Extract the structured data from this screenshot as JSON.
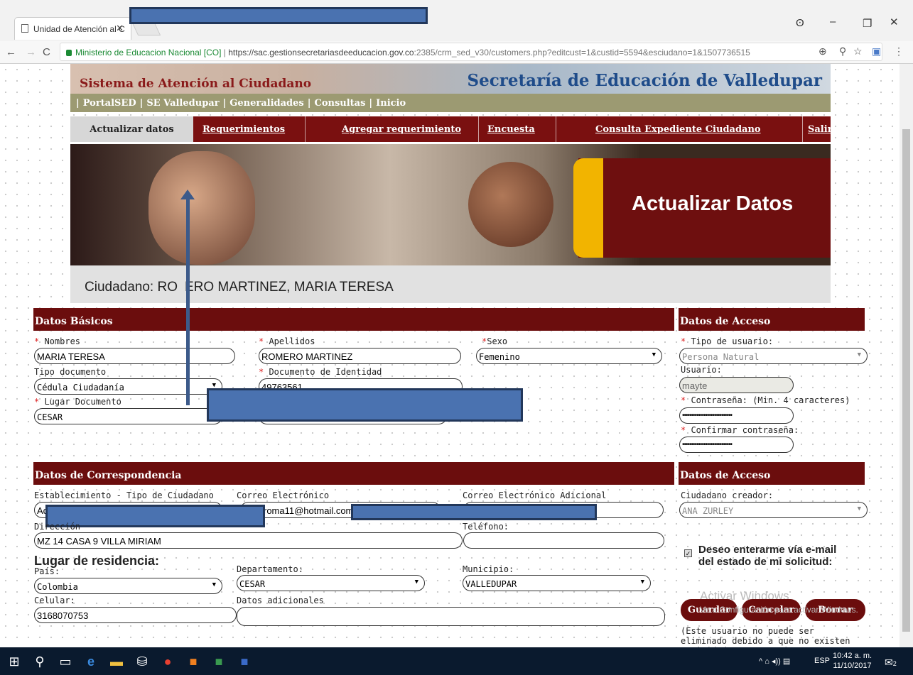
{
  "browser": {
    "tab_title": "Unidad de Atención al C",
    "url_org": "Ministerio de Educacion Nacional [CO]",
    "url_sep": " | ",
    "url_host": "https://sac.gestionsecretariasdeeducacion.gov.co",
    "url_path": ":2385/crm_sed_v30/customers.php?editcust=1&custid=5594&esciudano=1&1507736515"
  },
  "banner": {
    "left": "Sistema de Atención al Ciudadano",
    "right": "Secretaría de Educación de Valledupar"
  },
  "top_menu": [
    "PortalSED",
    "SE Valledupar",
    "Generalidades",
    "Consultas",
    "Inicio"
  ],
  "nav": {
    "active": "Actualizar datos",
    "items": [
      "Requerimientos",
      "Agregar requerimiento",
      "Encuesta",
      "Consulta Expediente Ciudadano",
      "Salir"
    ]
  },
  "hero": {
    "title": "Actualizar Datos"
  },
  "citizen": {
    "label": "Ciudadano: RO",
    "rest": "ERO MARTINEZ, MARIA TERESA"
  },
  "basic": {
    "header": "Datos Básicos",
    "nombres_label": "Nombres",
    "nombres": "MARIA TERESA",
    "apellidos_label": "Apellidos",
    "apellidos": "ROMERO MARTINEZ",
    "sexo_label": "Sexo",
    "sexo": "Femenino",
    "tipo_doc_label": "Tipo documento",
    "tipo_doc": "Cédula Ciudadanía",
    "doc_label": "Documento de Identidad",
    "doc": "49763561",
    "lugar_label": "Lugar Documento",
    "lugar": "CESAR"
  },
  "access": {
    "header": "Datos de Acceso",
    "tipo_label": "Tipo de usuario:",
    "tipo": "Persona Natural",
    "usuario_label": "Usuario:",
    "usuario": "mayte",
    "pass_label": "Contraseña: (Min. 4 caracteres)",
    "pass": "••••••••••••••••••••••••••••",
    "confirm_label": "Confirmar contraseña:",
    "confirm": "••••••••••••••••••••••••••••"
  },
  "corresp": {
    "header": "Datos de Correspondencia",
    "estab_label": "Establecimiento - Tipo de Ciudadano",
    "estab": "Ac",
    "email_label": "Correo Electrónico",
    "email": "roma11@hotmail.com",
    "email2_label": "Correo Electrónico Adicional",
    "dir_label": "Dirección",
    "dir": "MZ 14 CASA 9 VILLA MIRIAM",
    "tel_label": "Teléfono:",
    "resid": "Lugar de residencia:",
    "pais_label": "País:",
    "pais": "Colombia",
    "depto_label": "Departamento:",
    "depto": "CESAR",
    "muni_label": "Municipio:",
    "muni": "VALLEDUPAR",
    "cel_label": "Celular:",
    "cel": "3168070753",
    "adic_label": "Datos adicionales"
  },
  "access2": {
    "header": "Datos de Acceso",
    "creador_label": "Ciudadano creador:",
    "creador": "ANA ZURLEY",
    "email_opt": "Deseo enterarme vía e-mail del estado de mi solicitud:"
  },
  "buttons": {
    "save": "Guardar",
    "cancel": "Cancelar",
    "delete": "Borrar"
  },
  "note": "(Este usuario no puede ser eliminado debido a que no existen actividades pertenecientes a",
  "watermark": {
    "line1": "Activar Windows",
    "line2": "Ve a Configuración para activar Windows."
  },
  "taskbar": {
    "lang": "ESP",
    "time": "10:42 a. m.",
    "date": "11/10/2017",
    "notif": "2"
  }
}
